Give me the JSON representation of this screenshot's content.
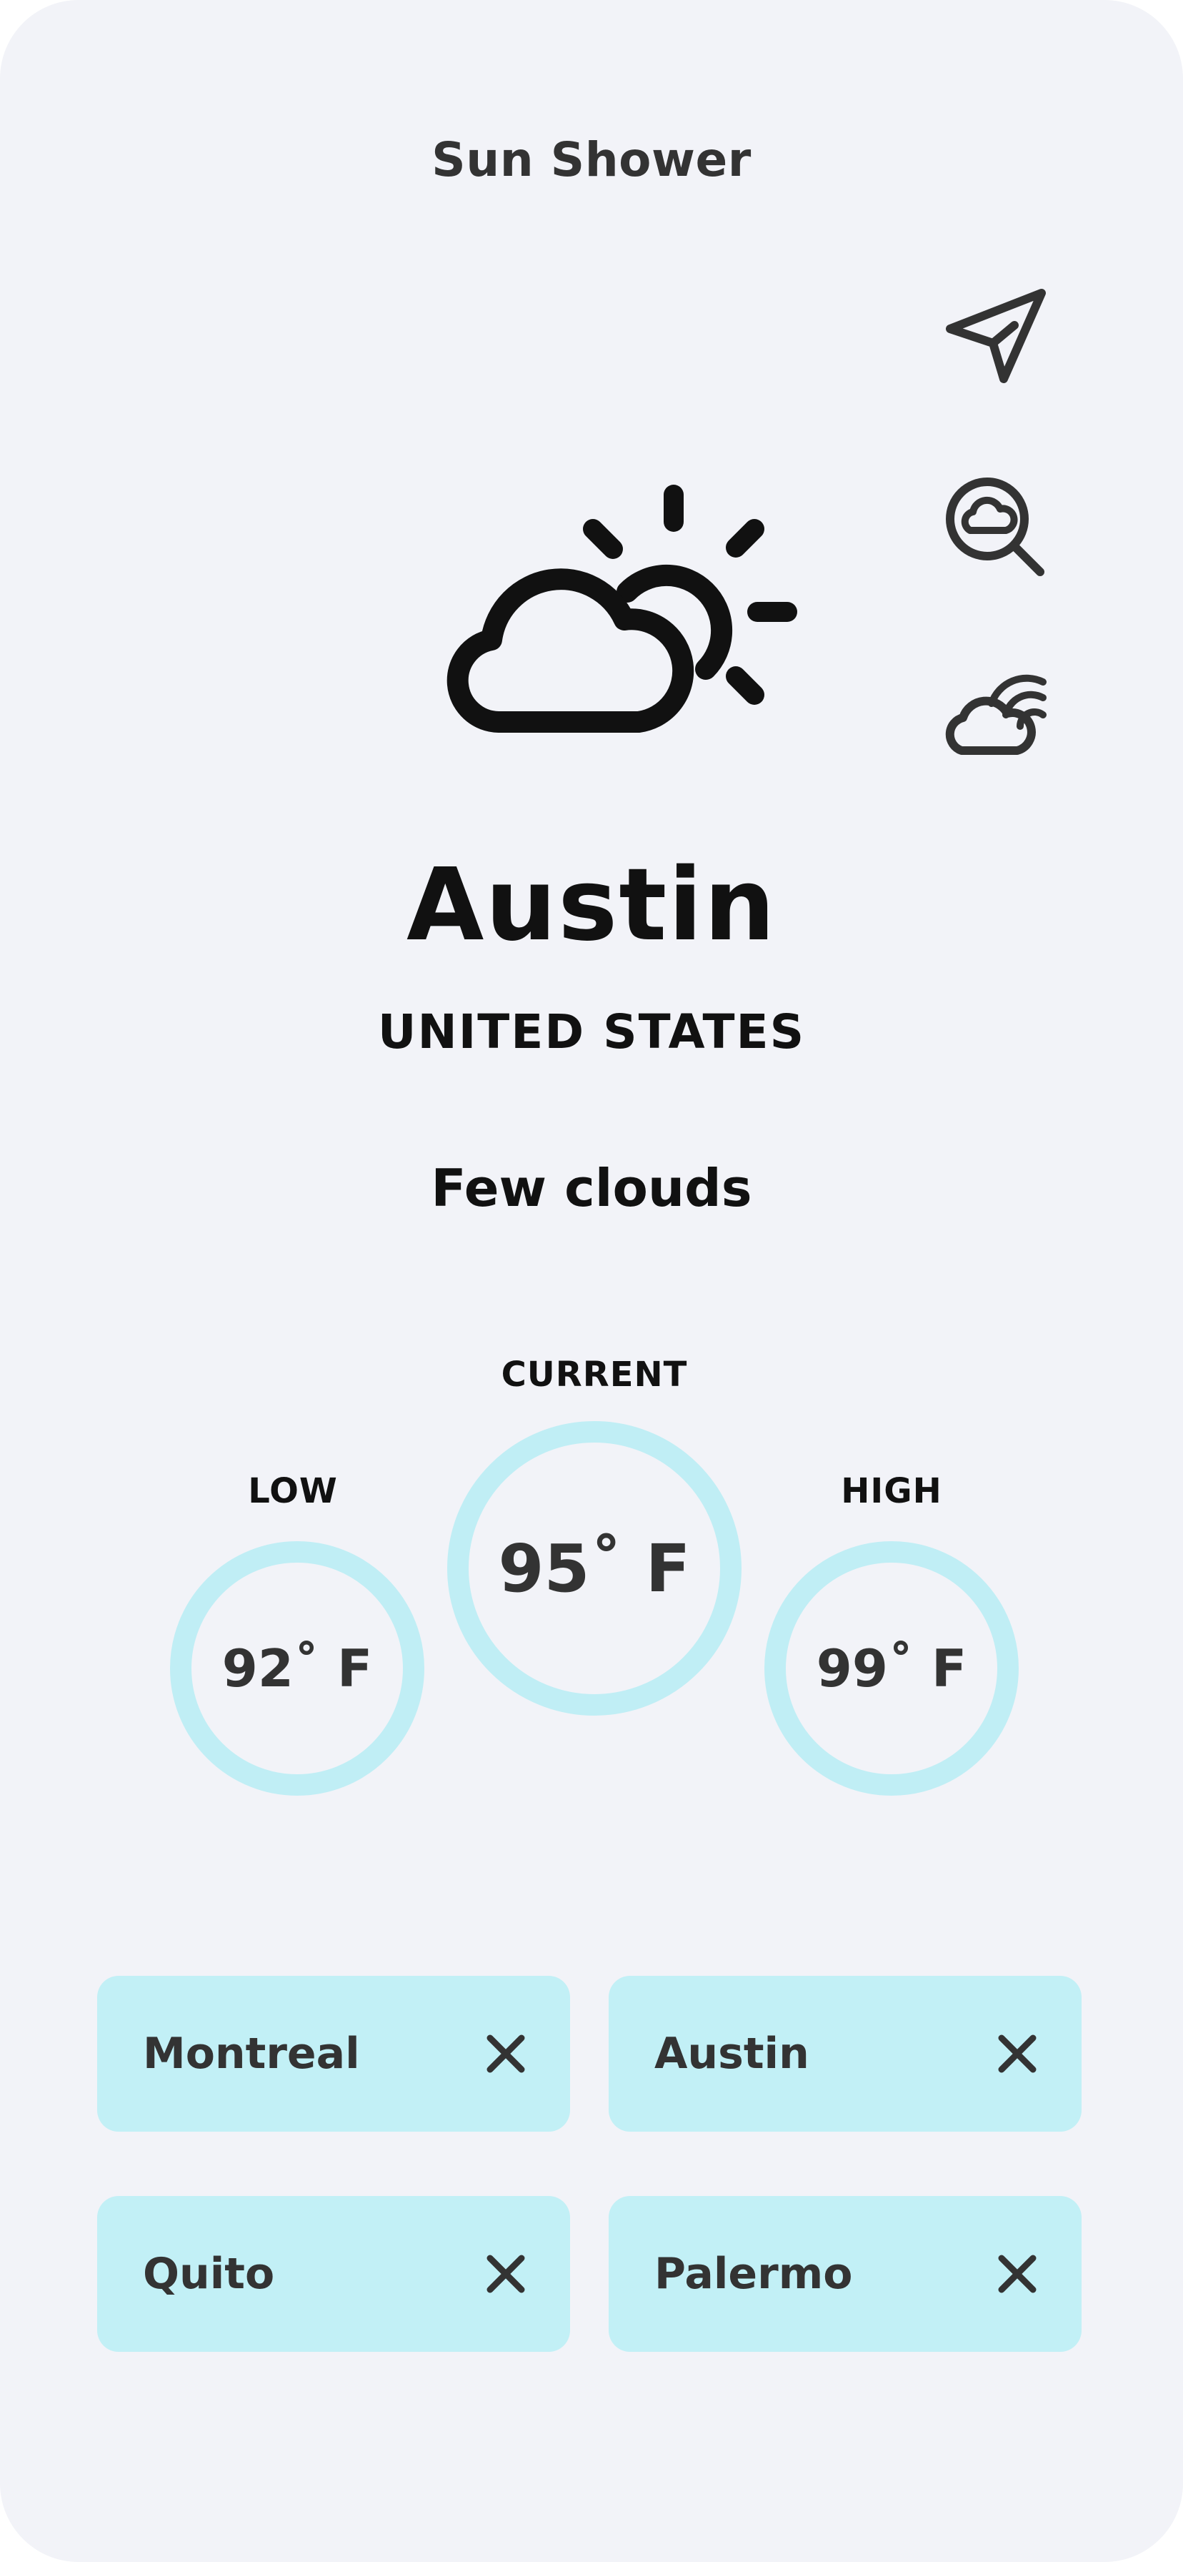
{
  "app": {
    "title": "Sun Shower"
  },
  "icons": {
    "location": "navigation-arrow-icon",
    "search": "cloud-search-icon",
    "weather": "cloud-rainbow-icon",
    "condition": "partly-cloudy-icon"
  },
  "location": {
    "city": "Austin",
    "country": "UNITED STATES"
  },
  "weather": {
    "condition": "Few clouds"
  },
  "temperatures": {
    "low": {
      "label": "LOW",
      "value": "92˚ F"
    },
    "current": {
      "label": "CURRENT",
      "value": "95˚ F"
    },
    "high": {
      "label": "HIGH",
      "value": "99˚ F"
    }
  },
  "saved_cities": [
    {
      "name": "Montreal"
    },
    {
      "name": "Austin"
    },
    {
      "name": "Quito"
    },
    {
      "name": "Palermo"
    }
  ],
  "colors": {
    "background": "#f2f3f8",
    "accent": "#c0eef5",
    "text": "#333333"
  }
}
